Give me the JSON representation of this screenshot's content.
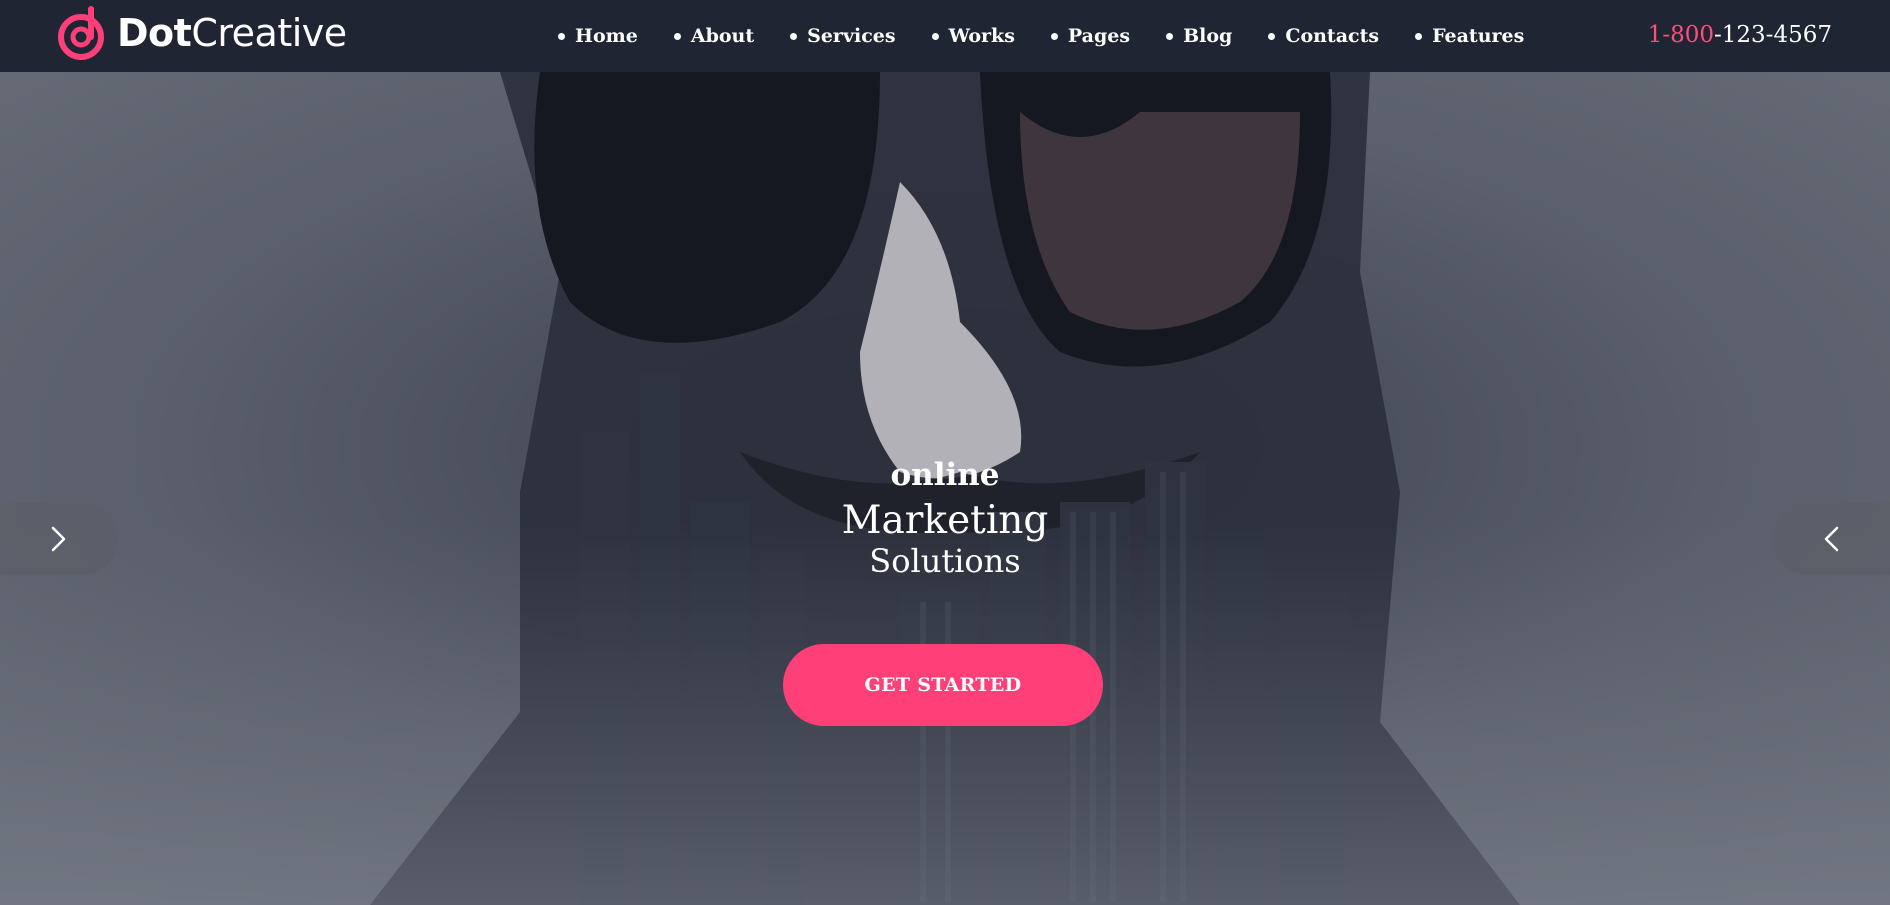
{
  "brand": {
    "name_bold": "Dot",
    "name_light": "Creative",
    "accent_color": "#ff3f78",
    "icon": "dot-creative-logo-icon"
  },
  "nav": {
    "items": [
      {
        "label": "Home"
      },
      {
        "label": "About"
      },
      {
        "label": "Services"
      },
      {
        "label": "Works"
      },
      {
        "label": "Pages"
      },
      {
        "label": "Blog"
      },
      {
        "label": "Contacts"
      },
      {
        "label": "Features"
      }
    ]
  },
  "phone": {
    "prefix": "1-800",
    "number": "-123-4567"
  },
  "hero": {
    "line1": "online",
    "line2": "Marketing",
    "line3": "Solutions",
    "cta_label": "GET STARTED",
    "prev_icon": "chevron-right-icon",
    "next_icon": "chevron-left-icon"
  },
  "colors": {
    "header_bg": "#1f2532",
    "hero_overlay": "#5f6470",
    "cta_bg": "#ff3f78"
  }
}
